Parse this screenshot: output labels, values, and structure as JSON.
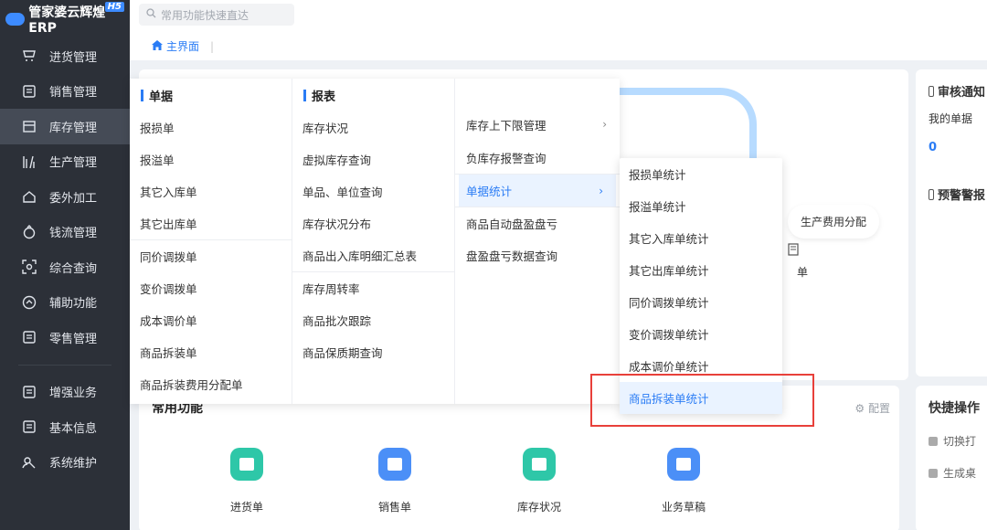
{
  "app": {
    "logo_text": "管家婆云辉煌ERP",
    "badge": "H5"
  },
  "sidebar": {
    "items": [
      {
        "label": "进货管理",
        "icon": "cart-icon"
      },
      {
        "label": "销售管理",
        "icon": "sales-icon"
      },
      {
        "label": "库存管理",
        "icon": "inventory-icon",
        "active": true
      },
      {
        "label": "生产管理",
        "icon": "production-icon"
      },
      {
        "label": "委外加工",
        "icon": "home-icon"
      },
      {
        "label": "钱流管理",
        "icon": "money-icon"
      },
      {
        "label": "综合查询",
        "icon": "query-icon"
      },
      {
        "label": "辅助功能",
        "icon": "assist-icon"
      },
      {
        "label": "零售管理",
        "icon": "retail-icon"
      }
    ],
    "items2": [
      {
        "label": "增强业务",
        "icon": "enhance-icon"
      },
      {
        "label": "基本信息",
        "icon": "info-icon"
      },
      {
        "label": "系统维护",
        "icon": "maintenance-icon"
      }
    ]
  },
  "search": {
    "placeholder": "常用功能快速直达"
  },
  "breadcrumb": {
    "home": "主界面",
    "divider": "|"
  },
  "dropdown": {
    "col1_header": "单据",
    "col1_group1": [
      "报损单",
      "报溢单",
      "其它入库单",
      "其它出库单"
    ],
    "col1_group2": [
      "同价调拨单",
      "变价调拨单",
      "成本调价单",
      "商品拆装单",
      "商品拆装费用分配单"
    ],
    "col2_header": "报表",
    "col2_group1": [
      "库存状况",
      "虚拟库存查询",
      "单品、单位查询",
      "库存状况分布",
      "商品出入库明细汇总表"
    ],
    "col2_group2": [
      "库存周转率",
      "商品批次跟踪",
      "商品保质期查询"
    ],
    "col3_items": [
      {
        "label": "库存上下限管理",
        "arrow": "›"
      },
      {
        "label": "负库存报警查询",
        "arrow": ""
      },
      {
        "label": "单据统计",
        "arrow": "›",
        "selected": true
      },
      {
        "label": "商品自动盘盈盘亏",
        "arrow": ""
      },
      {
        "label": "盘盈盘亏数据查询",
        "arrow": ""
      }
    ]
  },
  "submenu": {
    "items": [
      "报损单统计",
      "报溢单统计",
      "其它入库单统计",
      "其它出库单统计",
      "同价调拨单统计",
      "变价调拨单统计",
      "成本调价单统计",
      "商品拆装单统计"
    ],
    "highlighted_index": 7
  },
  "flow": {
    "node_label": "生产费用分配",
    "doc_label": "单"
  },
  "audit": {
    "title": "审核通知",
    "sub": "我的单据",
    "count": "0",
    "title2": "预警警报"
  },
  "common": {
    "title": "常用功能",
    "config": "配置",
    "items": [
      {
        "label": "进货单",
        "color": "#2ec7a8"
      },
      {
        "label": "销售单",
        "color": "#4b8ff7"
      },
      {
        "label": "库存状况",
        "color": "#2ec7a8"
      },
      {
        "label": "业务草稿",
        "color": "#4b8ff7"
      }
    ]
  },
  "shortcut": {
    "title": "快捷操作",
    "row1": "切换打",
    "row2": "生成桌"
  }
}
